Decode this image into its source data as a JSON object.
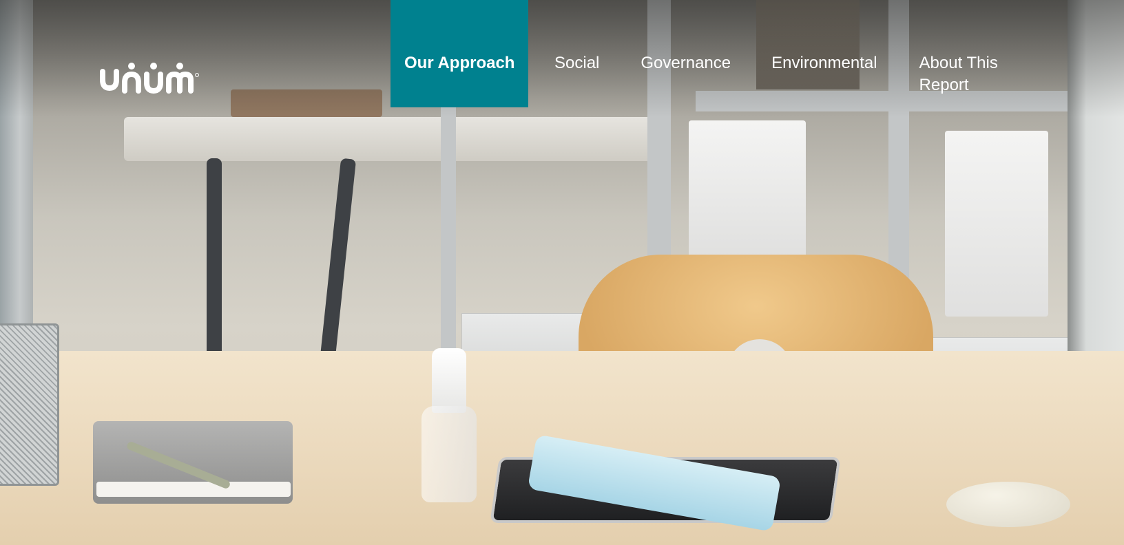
{
  "brand": {
    "logo_name": "unum",
    "accent_color": "#00818f"
  },
  "nav": {
    "items": [
      {
        "label": "Our Approach",
        "active": true
      },
      {
        "label": "Social",
        "active": false
      },
      {
        "label": "Governance",
        "active": false
      },
      {
        "label": "Environmental",
        "active": false
      },
      {
        "label": "About This Report",
        "active": false
      }
    ]
  }
}
